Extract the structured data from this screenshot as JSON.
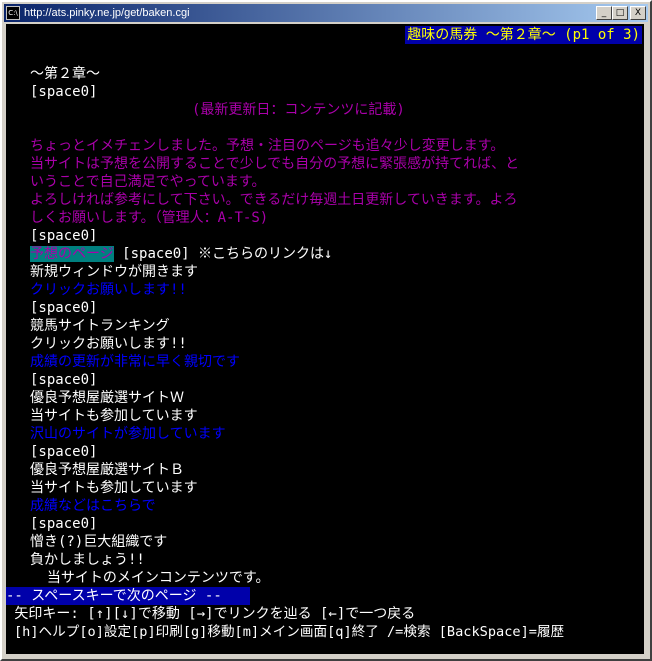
{
  "window": {
    "title": "http://ats.pinky.ne.jp/get/baken.cgi",
    "icon_text": "C:\\",
    "controls": {
      "minimize": "_",
      "maximize": "□",
      "close": "X"
    }
  },
  "page": {
    "header": "趣味の馬券 ～第２章～ (p1 of 3)",
    "chapter": "～第２章～",
    "space_tag": "[space0]",
    "updated": "(最新更新日：コンテンツに記載)",
    "intro": [
      "ちょっとイメチェンしました。予想・注目のページも追々少し変更します。",
      "当サイトは予想を公開することで少しでも自分の予想に緊張感が持てれば、と",
      "いうことで自己満足でやっています。",
      "よろしければ参考にして下さい。できるだけ毎週土日更新していきます。よろ",
      "しくお願いします。（管理人：A-T-S)"
    ],
    "prediction_link": "予想のページ",
    "prediction_note": " ※こちらのリンクは↓",
    "new_window": "新規ウィンドウが開きます",
    "click_please_link": "クリックお願いします!!",
    "ranking_title": "競馬サイトランキング",
    "ranking_click": "クリックお願いします!!",
    "ranking_link": "成績の更新が非常に早く親切です",
    "siteW_title": "優良予想屋厳選サイトＷ",
    "siteW_join": "当サイトも参加しています",
    "siteW_link": "沢山のサイトが参加しています",
    "siteB_title": "優良予想屋厳選サイトＢ",
    "siteB_join": "当サイトも参加しています",
    "siteB_link": "成績などはこちらで",
    "org_line1": "憎き(?)巨大組織です",
    "org_line2": "負かしましょう!!",
    "main_contents": "  当サイトのメインコンテンツです。"
  },
  "status": {
    "more": "-- スペースキーで次のページ --",
    "help1": " 矢印キー: [↑][↓]で移動 [→]でリンクを辿る [←]で一つ戻る",
    "help2": "[h]ヘルプ[o]設定[p]印刷[g]移動[m]メイン画面[q]終了 /=検索 [BackSpace]=履歴"
  }
}
